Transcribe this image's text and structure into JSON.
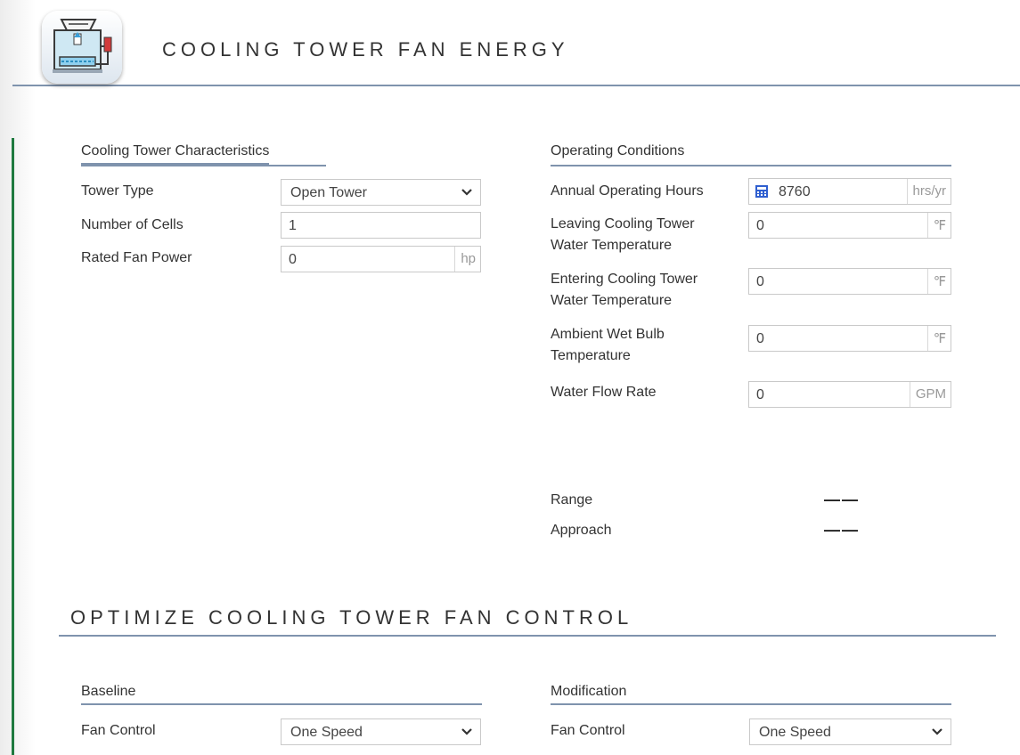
{
  "header": {
    "title": "COOLING TOWER FAN ENERGY"
  },
  "characteristics": {
    "title": "Cooling Tower Characteristics",
    "tower_type": {
      "label": "Tower Type",
      "value": "Open Tower"
    },
    "num_cells": {
      "label": "Number of Cells",
      "value": "1"
    },
    "rated_fan_power": {
      "label": "Rated Fan Power",
      "value": "0",
      "unit": "hp"
    }
  },
  "operating": {
    "title": "Operating Conditions",
    "hours": {
      "label": "Annual Operating Hours",
      "value": "8760",
      "unit": "hrs/yr"
    },
    "leaving_temp": {
      "label_1": "Leaving Cooling Tower",
      "label_2": "Water Temperature",
      "value": "0",
      "unit": "℉"
    },
    "entering_temp": {
      "label_1": "Entering Cooling Tower",
      "label_2": "Water Temperature",
      "value": "0",
      "unit": "℉"
    },
    "wet_bulb": {
      "label_1": "Ambient Wet Bulb",
      "label_2": "Temperature",
      "value": "0",
      "unit": "℉"
    },
    "flow_rate": {
      "label": "Water Flow Rate",
      "value": "0",
      "unit": "GPM"
    }
  },
  "results": {
    "range": {
      "label": "Range",
      "value": "——"
    },
    "approach": {
      "label": "Approach",
      "value": "——"
    }
  },
  "optimize": {
    "title": "OPTIMIZE COOLING TOWER FAN CONTROL",
    "baseline": {
      "title": "Baseline",
      "fan_control_label": "Fan Control",
      "fan_control_value": "One Speed"
    },
    "modification": {
      "title": "Modification",
      "fan_control_label": "Fan Control",
      "fan_control_value": "One Speed"
    }
  },
  "icons": {
    "app": "cooling-tower-icon",
    "calculator": "calculator-icon",
    "dropdown": "chevron-down-icon"
  },
  "colors": {
    "accent_line": "#7f93ad",
    "edge_green": "#1f7a3f",
    "calculator_blue": "#2f5fd0"
  }
}
